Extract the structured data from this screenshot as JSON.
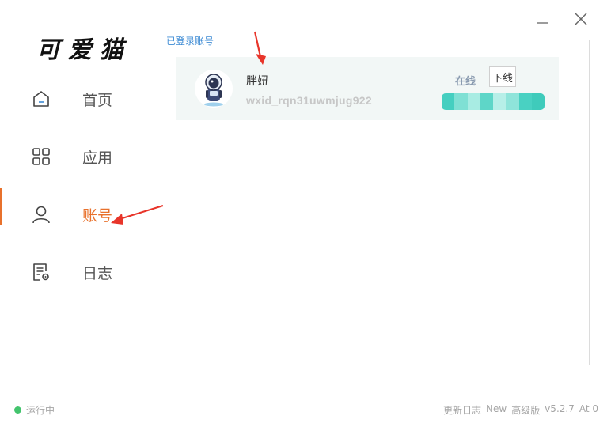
{
  "app": {
    "logo_text": "可爱猫"
  },
  "window": {
    "minimize_icon": "minimize-icon",
    "close_icon": "close-icon"
  },
  "nav": {
    "items": [
      {
        "label": "首页",
        "icon": "home-icon",
        "active": false
      },
      {
        "label": "应用",
        "icon": "apps-grid-icon",
        "active": false
      },
      {
        "label": "账号",
        "icon": "user-icon",
        "active": true
      },
      {
        "label": "日志",
        "icon": "log-document-icon",
        "active": false
      }
    ],
    "active_color": "#e8712c"
  },
  "panel": {
    "legend": "已登录账号",
    "accounts": [
      {
        "nickname": "胖妞",
        "wxid": "wxid_rqn31uwmjug922",
        "status": "在线",
        "action_label": "下线"
      }
    ]
  },
  "footer": {
    "status_text": "运行中",
    "status_color": "#43c46d",
    "changelog": "更新日志",
    "new_label": "New",
    "edition": "高级版",
    "version": "v5.2.7",
    "at_label": "At 0"
  }
}
